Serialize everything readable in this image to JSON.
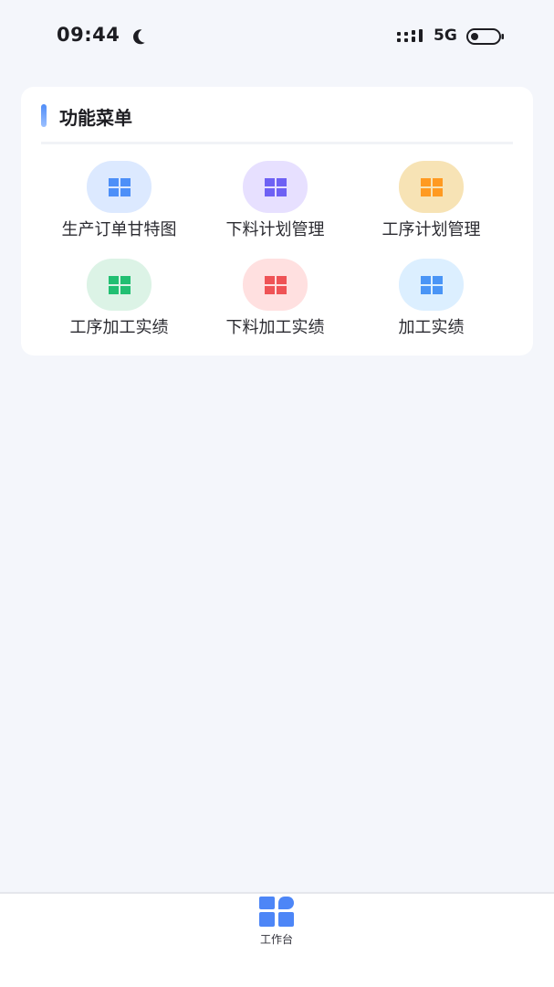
{
  "status_bar": {
    "time": "09:44",
    "moon_icon": "moon-icon",
    "signal_icon": "signal-icon",
    "network": "5G",
    "battery_icon": "battery-icon"
  },
  "menu_card": {
    "title": "功能菜单",
    "items": [
      {
        "label": "生产订单甘特图",
        "icon": "grid-icon",
        "color": "#4d8ff8",
        "bg": "#dce9ff"
      },
      {
        "label": "下料计划管理",
        "icon": "grid-icon",
        "color": "#6e61f4",
        "bg": "#e7e0ff"
      },
      {
        "label": "工序计划管理",
        "icon": "grid-icon",
        "color": "#ff9a21",
        "bg": "#f7e3b5"
      },
      {
        "label": "工序加工实绩",
        "icon": "grid-icon",
        "color": "#21bf72",
        "bg": "#dcf3e6"
      },
      {
        "label": "下料加工实绩",
        "icon": "grid-icon",
        "color": "#ef5356",
        "bg": "#ffe0e0"
      },
      {
        "label": "加工实绩",
        "icon": "grid-icon",
        "color": "#4a95f6",
        "bg": "#dcefff"
      }
    ]
  },
  "tab_bar": {
    "active_tab": {
      "label": "工作台",
      "icon": "workbench-icon",
      "color": "#4d86f7"
    }
  }
}
